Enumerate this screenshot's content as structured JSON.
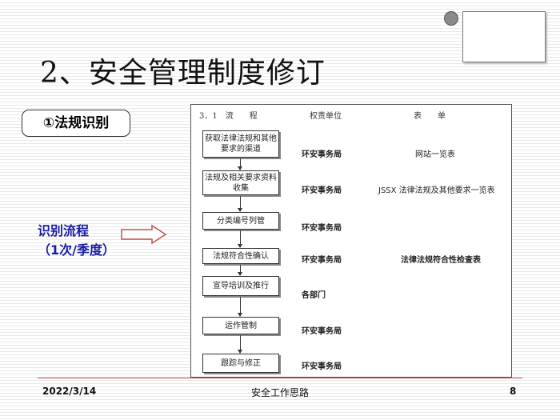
{
  "title": "2、安全管理制度修订",
  "pill_label": "①法规识别",
  "side_label": {
    "line1": "识别流程",
    "line2": "（1次/季度）"
  },
  "table": {
    "headers": {
      "process": "3．1　流　　程",
      "unit": "权责单位",
      "form": "表　　单"
    },
    "steps": [
      {
        "label": "获取法律法规和其他要求的渠道",
        "unit": "环安事务局",
        "form": "网站一览表"
      },
      {
        "label": "法规及相关要求资料收集",
        "unit": "环安事务局",
        "form": "JSSX 法律法规及其他要求一览表"
      },
      {
        "label": "分类编号列管",
        "unit": "环安事务局",
        "form": ""
      },
      {
        "label": "法规符合性确认",
        "unit": "环安事务局",
        "form": "法律法规符合性检查表"
      },
      {
        "label": "宣导培训及推行",
        "unit": "各部门",
        "form": ""
      },
      {
        "label": "运作管制",
        "unit": "环安事务局",
        "form": ""
      },
      {
        "label": "跟踪与修正",
        "unit": "环安事务局",
        "form": ""
      }
    ]
  },
  "footer": {
    "date": "2022/3/14",
    "center": "安全工作思路",
    "page": "8"
  },
  "colors": {
    "accent_blue": "#1a1aa8",
    "arrow_red": "#c0504d",
    "footer_line": "#c0504d"
  },
  "icons": {
    "arrow": "right-arrow-outline-icon"
  }
}
